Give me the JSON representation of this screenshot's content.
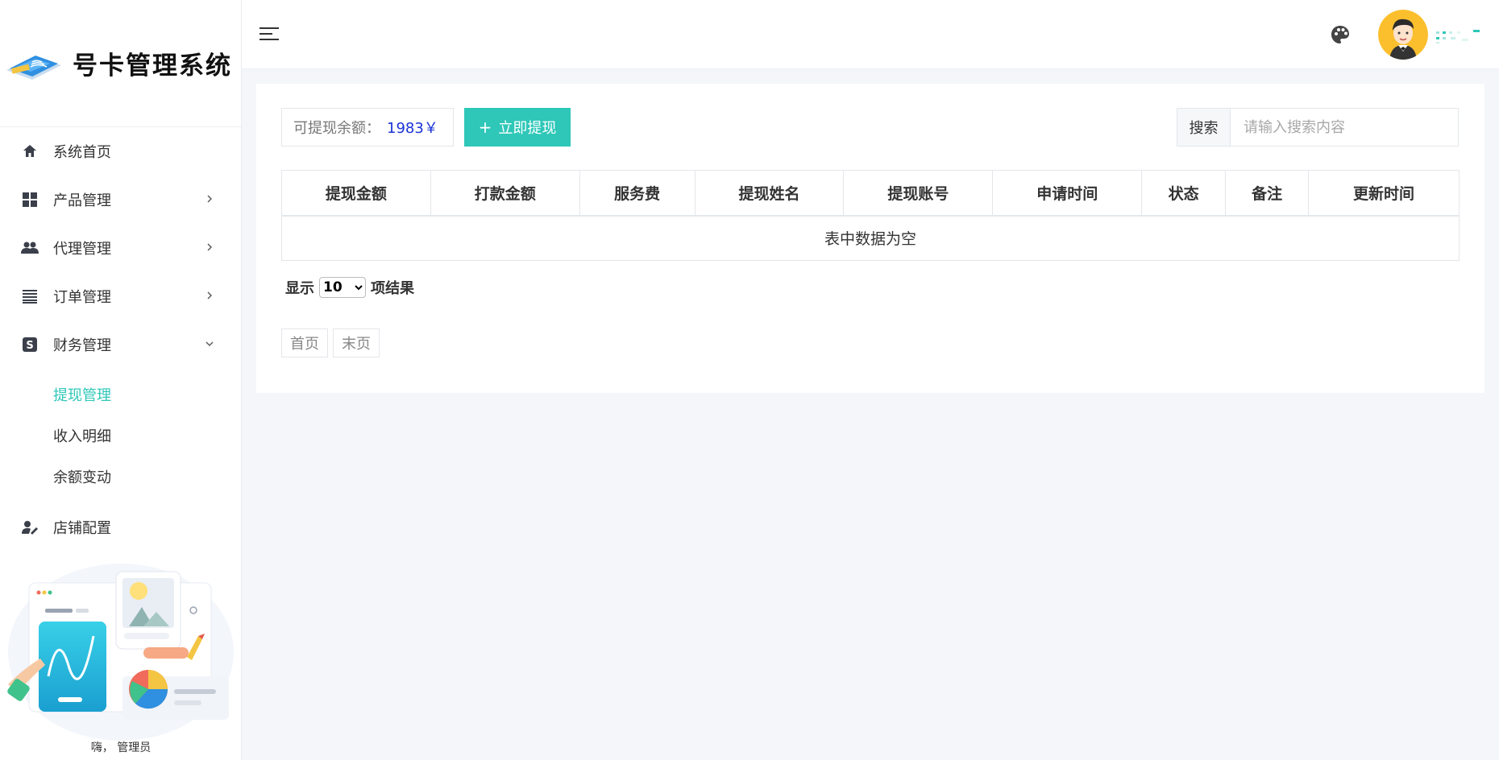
{
  "app": {
    "title": "号卡管理系统"
  },
  "sidebar": {
    "items": [
      {
        "label": "系统首页",
        "icon": "home-icon"
      },
      {
        "label": "产品管理",
        "icon": "grid-icon"
      },
      {
        "label": "代理管理",
        "icon": "users-icon"
      },
      {
        "label": "订单管理",
        "icon": "list-icon"
      },
      {
        "label": "财务管理",
        "icon": "dollar-icon"
      },
      {
        "label": "店铺配置",
        "icon": "user-edit-icon"
      }
    ],
    "finance_submenu": [
      {
        "label": "提现管理",
        "active": true
      },
      {
        "label": "收入明细",
        "active": false
      },
      {
        "label": "余额变动",
        "active": false
      }
    ],
    "greeting": "嗨， 管理员"
  },
  "toolbar": {
    "balance_label": "可提现余额：",
    "balance_value": "1983￥",
    "withdraw_label": "立即提现",
    "withdraw_plus": "+"
  },
  "search": {
    "label": "搜索",
    "placeholder": "请输入搜索内容"
  },
  "table": {
    "columns": [
      "提现金额",
      "打款金额",
      "服务费",
      "提现姓名",
      "提现账号",
      "申请时间",
      "状态",
      "备注",
      "更新时间"
    ],
    "empty_text": "表中数据为空"
  },
  "pagination": {
    "show_label": "显示",
    "page_size": "10",
    "result_label": "项结果",
    "first_label": "首页",
    "last_label": "末页"
  },
  "colors": {
    "accent": "#2ec7b8",
    "balance": "#1a33d6"
  }
}
